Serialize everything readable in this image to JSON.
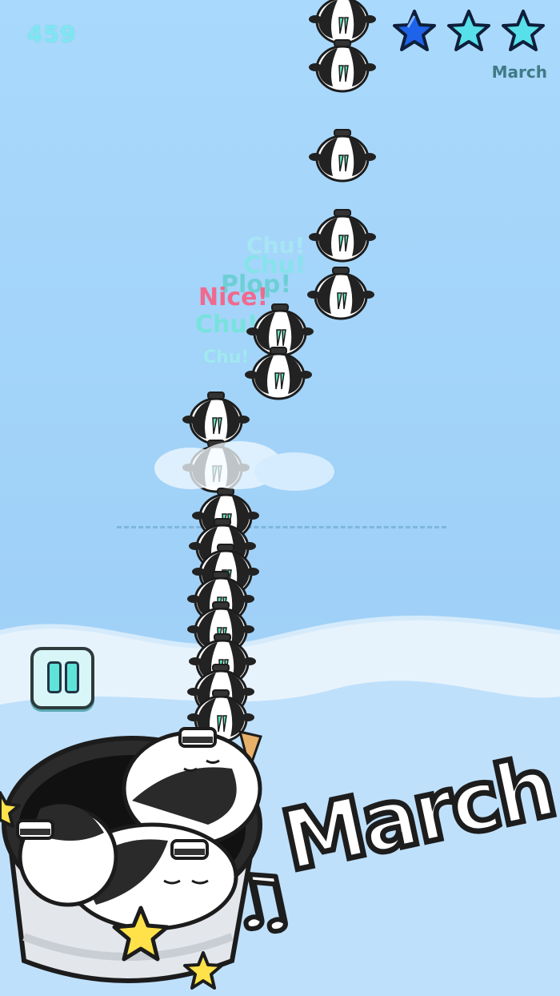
{
  "hud": {
    "score": "459",
    "level_name": "March",
    "stars_earned": 1,
    "stars_total": 3,
    "pause_icon": "pause-icon"
  },
  "popups": [
    {
      "text": "Chu!",
      "color": "#a9ecf2"
    },
    {
      "text": "Chu!",
      "color": "#86e3ea"
    },
    {
      "text": "Plop!",
      "color": "#6ccfd6"
    },
    {
      "text": "Nice!",
      "color": "#f06a8e"
    },
    {
      "text": "Chu!",
      "color": "#78e2dc"
    },
    {
      "text": "Chu!",
      "color": "#9fe9ef"
    }
  ],
  "song": {
    "note_icon": "music-note-icon",
    "title": "March"
  },
  "colors": {
    "sky": "#a8d8fb",
    "accent": "#5ee3d8",
    "star_filled": "#1e63e9",
    "star_empty": "#58e0ea",
    "pop_pink": "#f06a8e"
  }
}
